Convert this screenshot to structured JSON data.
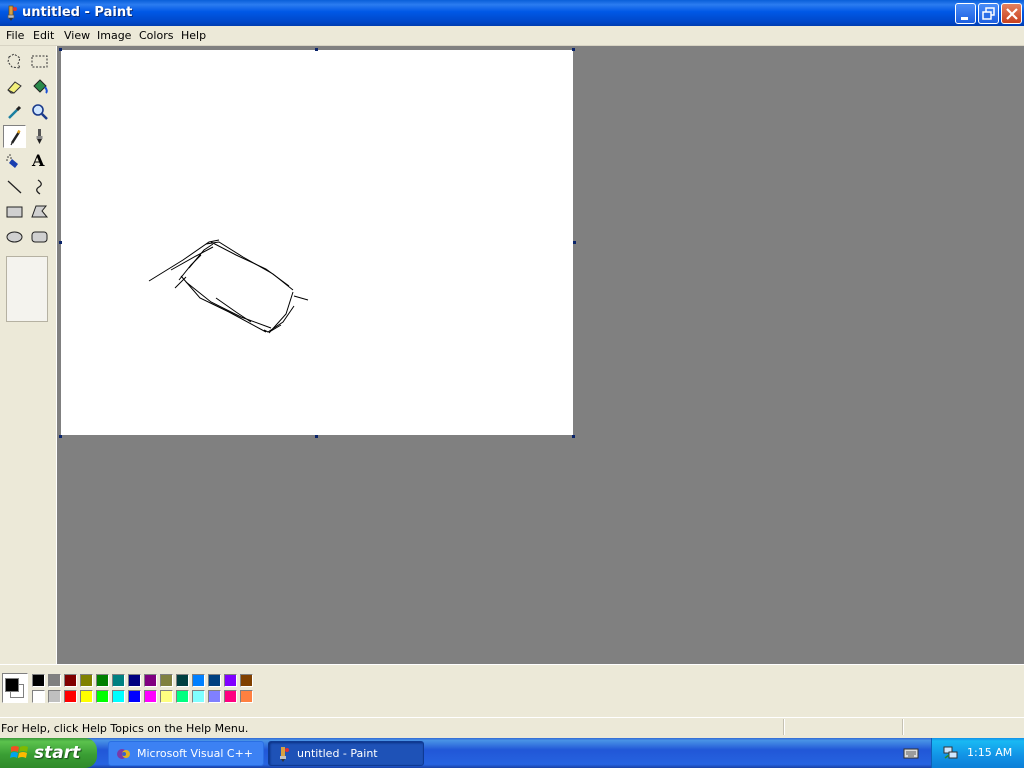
{
  "window": {
    "title": "untitled - Paint",
    "controls": [
      "minimize",
      "restore",
      "close"
    ]
  },
  "menu": [
    "File",
    "Edit",
    "View",
    "Image",
    "Colors",
    "Help"
  ],
  "toolbox": {
    "selected_tool": "pencil",
    "tools": [
      {
        "name": "free-form-select",
        "icon": "free-form-select-icon"
      },
      {
        "name": "select",
        "icon": "select-icon"
      },
      {
        "name": "eraser",
        "icon": "eraser-icon"
      },
      {
        "name": "fill-with-color",
        "icon": "fill-icon"
      },
      {
        "name": "pick-color",
        "icon": "eyedropper-icon"
      },
      {
        "name": "magnifier",
        "icon": "magnifier-icon"
      },
      {
        "name": "pencil",
        "icon": "pencil-icon"
      },
      {
        "name": "brush",
        "icon": "brush-icon"
      },
      {
        "name": "airbrush",
        "icon": "airbrush-icon"
      },
      {
        "name": "text",
        "icon": "text-icon",
        "glyph": "A"
      },
      {
        "name": "line",
        "icon": "line-icon"
      },
      {
        "name": "curve",
        "icon": "curve-icon"
      },
      {
        "name": "rectangle",
        "icon": "rectangle-icon"
      },
      {
        "name": "polygon",
        "icon": "polygon-icon"
      },
      {
        "name": "ellipse",
        "icon": "ellipse-icon"
      },
      {
        "name": "rounded-rectangle",
        "icon": "rounded-rectangle-icon"
      }
    ]
  },
  "colors": {
    "foreground": "#000000",
    "background": "#ffffff",
    "palette_top": [
      "#000000",
      "#808080",
      "#800000",
      "#808000",
      "#008000",
      "#008080",
      "#000080",
      "#800080",
      "#808040",
      "#004040",
      "#0080ff",
      "#004080",
      "#8000ff",
      "#804000"
    ],
    "palette_bottom": [
      "#ffffff",
      "#c0c0c0",
      "#ff0000",
      "#ffff00",
      "#00ff00",
      "#00ffff",
      "#0000ff",
      "#ff00ff",
      "#ffff80",
      "#00ff80",
      "#80ffff",
      "#8080ff",
      "#ff0080",
      "#ff8040"
    ]
  },
  "status": {
    "help_text": "For Help, click Help Topics on the Help Menu."
  },
  "taskbar": {
    "start_label": "start",
    "tasks": [
      {
        "label": "Microsoft Visual C++",
        "active": false
      },
      {
        "label": "untitled - Paint",
        "active": true
      }
    ],
    "clock": "1:15 AM"
  }
}
